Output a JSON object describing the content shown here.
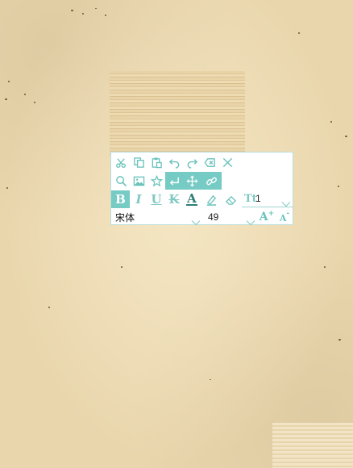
{
  "colors": {
    "accent": "#76cbc4",
    "icon": "#69c2bb",
    "paper": "#e9d6ad"
  },
  "toolbar": {
    "row1": [
      {
        "name": "cut-icon"
      },
      {
        "name": "copy-icon"
      },
      {
        "name": "paste-icon"
      },
      {
        "name": "undo-icon"
      },
      {
        "name": "redo-icon"
      },
      {
        "name": "backspace-icon"
      },
      {
        "name": "close-icon"
      }
    ],
    "row2": [
      {
        "name": "search-icon"
      },
      {
        "name": "image-icon"
      },
      {
        "name": "sticker-icon"
      },
      {
        "name": "enter-icon",
        "active": true
      },
      {
        "name": "move-icon",
        "active": true
      },
      {
        "name": "link-icon",
        "active": true
      }
    ],
    "format": {
      "bold": "B",
      "italic": "I",
      "underline": "U",
      "strike": "K",
      "color": "A",
      "size_prefix": "Tt",
      "size_value": "1"
    },
    "font": {
      "family": "宋体",
      "size": "49",
      "grow": "A",
      "shrink": "A"
    }
  }
}
